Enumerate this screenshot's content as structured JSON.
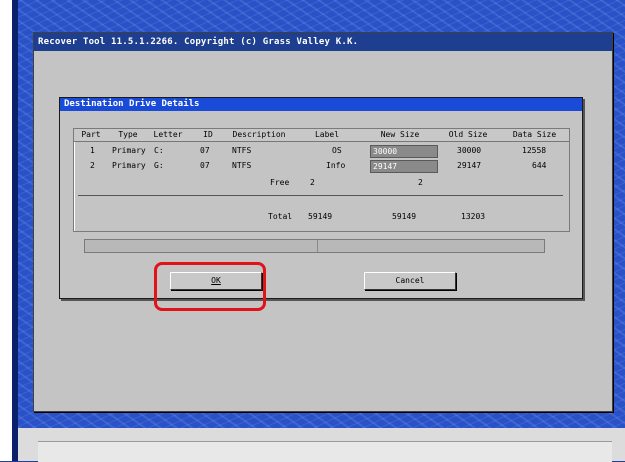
{
  "window": {
    "title": "Recover Tool 11.5.1.2266.  Copyright (c) Grass Valley K.K."
  },
  "dialog": {
    "title": "Destination Drive Details",
    "columns": [
      "Part",
      "Type",
      "Letter",
      "ID",
      "Description",
      "Label",
      "New Size",
      "Old Size",
      "Data Size"
    ],
    "rows": [
      {
        "part": "1",
        "type": "Primary",
        "letter": "C:",
        "id": "07",
        "description": "NTFS",
        "label": "OS",
        "new_size": "30000",
        "old_size": "30000",
        "data_size": "12558"
      },
      {
        "part": "2",
        "type": "Primary",
        "letter": "G:",
        "id": "07",
        "description": "NTFS",
        "label": "Info",
        "new_size": "29147",
        "old_size": "29147",
        "data_size": "644"
      }
    ],
    "free": {
      "label": "Free",
      "value": "2",
      "new_value": "2"
    },
    "total": {
      "label": "Total",
      "value": "59149",
      "new_size": "59149",
      "data_size": "13203"
    },
    "ok_label": "OK",
    "cancel_label": "Cancel"
  },
  "colors": {
    "highlight": "#e0131a",
    "title_bar": "#1a4bd8",
    "dialog_bg": "#c4c4c4"
  }
}
